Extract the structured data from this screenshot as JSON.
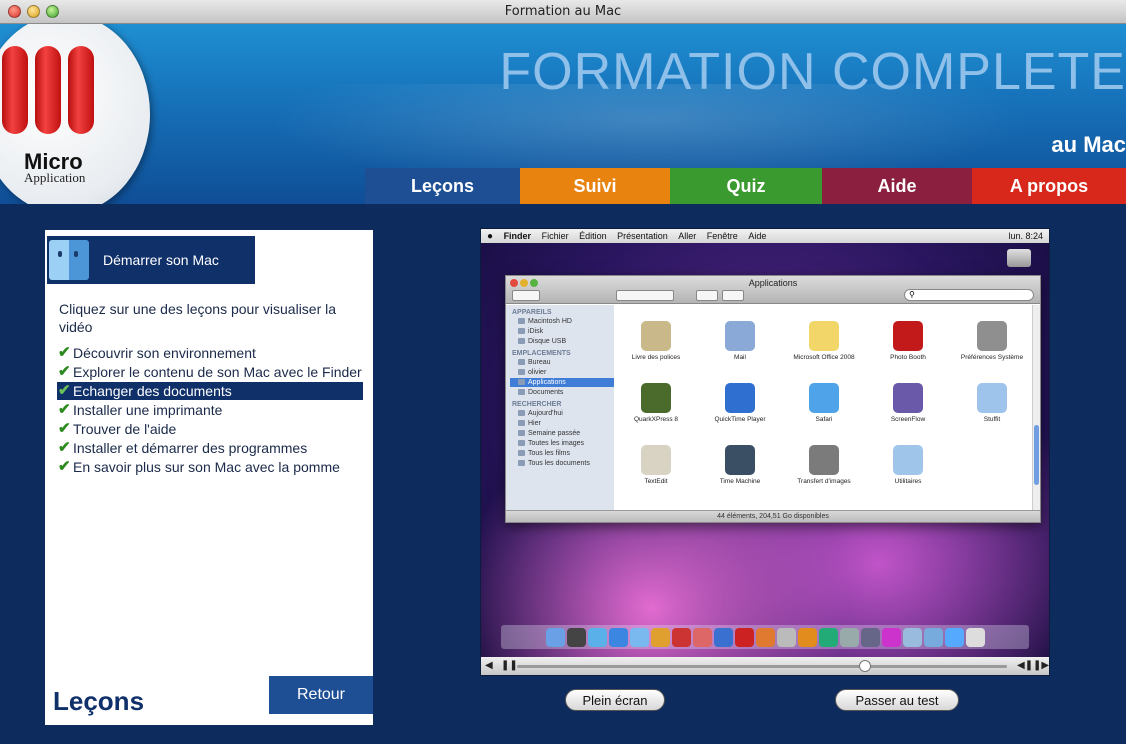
{
  "window": {
    "title": "Formation au Mac"
  },
  "header": {
    "logo_line1": "Micro",
    "logo_line2": "Application",
    "title": "FORMATION COMPLETE",
    "subtitle": "au Mac"
  },
  "nav": {
    "tabs": [
      {
        "label": "Leçons",
        "color": "#1e4f95"
      },
      {
        "label": "Suivi",
        "color": "#e88310"
      },
      {
        "label": "Quiz",
        "color": "#3a9a2f"
      },
      {
        "label": "Aide",
        "color": "#8a1f3f"
      },
      {
        "label": "A propos",
        "color": "#d8281c"
      }
    ]
  },
  "panel": {
    "header_icon": "finder-icon",
    "header_title": "Démarrer son Mac",
    "intro": "Cliquez sur une des leçons pour visualiser la vidéo",
    "lessons": [
      {
        "label": "Découvrir son environnement",
        "active": false
      },
      {
        "label": "Explorer le contenu de son Mac avec le Finder",
        "active": false
      },
      {
        "label": "Echanger des documents",
        "active": true
      },
      {
        "label": "Installer une imprimante",
        "active": false
      },
      {
        "label": "Trouver de l'aide",
        "active": false
      },
      {
        "label": "Installer et démarrer des programmes",
        "active": false
      },
      {
        "label": "En savoir plus sur son Mac avec la pomme",
        "active": false
      }
    ],
    "footer_title": "Leçons",
    "back_label": "Retour"
  },
  "video": {
    "menubar": {
      "apple": "",
      "items": [
        "Finder",
        "Fichier",
        "Édition",
        "Présentation",
        "Aller",
        "Fenêtre",
        "Aide"
      ],
      "status": "lun. 8:24"
    },
    "finder": {
      "title": "Applications",
      "status": "44 éléments, 204,51 Go disponibles",
      "sidebar": {
        "devices_head": "APPAREILS",
        "devices": [
          "Macintosh HD",
          "iDisk",
          "Disque USB"
        ],
        "places_head": "EMPLACEMENTS",
        "places": [
          "Bureau",
          "olivier",
          "Applications",
          "Documents"
        ],
        "search_head": "RECHERCHER",
        "searches": [
          "Aujourd'hui",
          "Hier",
          "Semaine passée",
          "Toutes les images",
          "Tous les films",
          "Tous les documents"
        ]
      },
      "apps": [
        {
          "name": "Livre des polices",
          "color": "#c9b98a"
        },
        {
          "name": "Mail",
          "color": "#8aa9d6"
        },
        {
          "name": "Microsoft Office 2008",
          "color": "#f2d66a"
        },
        {
          "name": "Photo Booth",
          "color": "#c21a1a"
        },
        {
          "name": "Préférences Système",
          "color": "#8f8f8f"
        },
        {
          "name": "QuarkXPress 8",
          "color": "#4a6b2c"
        },
        {
          "name": "QuickTime Player",
          "color": "#2f6fd0"
        },
        {
          "name": "Safari",
          "color": "#4fa3e8"
        },
        {
          "name": "ScreenFlow",
          "color": "#6a58a8"
        },
        {
          "name": "Stuffit",
          "color": "#9ec4ec"
        },
        {
          "name": "TextEdit",
          "color": "#d8d3c2"
        },
        {
          "name": "Time Machine",
          "color": "#3a4e64"
        },
        {
          "name": "Transfert d'images",
          "color": "#7b7b7b"
        },
        {
          "name": "Utilitaires",
          "color": "#9fc6ea"
        }
      ]
    },
    "dock_colors": [
      "#6aa0e6",
      "#444",
      "#5ab0e8",
      "#3a86e0",
      "#7ab8f0",
      "#e0a030",
      "#c33",
      "#d66",
      "#3a70d0",
      "#c22",
      "#e07a30",
      "#bbb",
      "#e28c1e",
      "#2a7",
      "#9aa",
      "#668",
      "#c3c",
      "#9bd",
      "#7ad",
      "#5af",
      "#ddd"
    ]
  },
  "buttons": {
    "fullscreen": "Plein écran",
    "test": "Passer au test"
  }
}
